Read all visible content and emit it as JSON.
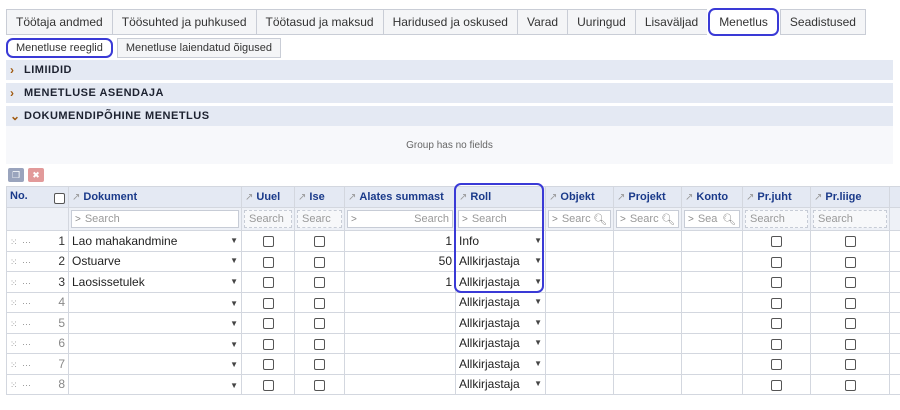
{
  "top_tabs": [
    "Töötaja andmed",
    "Töösuhted ja puhkused",
    "Töötasud ja maksud",
    "Haridused ja oskused",
    "Varad",
    "Uuringud",
    "Lisaväljad",
    "Menetlus",
    "Seadistused"
  ],
  "active_top_tab": "Menetlus",
  "sub_tabs": [
    "Menetluse reeglid",
    "Menetluse laiendatud õigused"
  ],
  "groups": {
    "limiidid": "LIMIIDID",
    "asendaja": "MENETLUSE ASENDAJA",
    "dokument": "DOKUMENDIPÕHINE MENETLUS",
    "empty_note": "Group has no fields"
  },
  "columns": {
    "no": "No.",
    "dokument": "Dokument",
    "uuel": "Uuel",
    "ise": "Ise",
    "alates": "Alates summast",
    "roll": "Roll",
    "objekt": "Objekt",
    "projekt": "Projekt",
    "konto": "Konto",
    "prjuht": "Pr.juht",
    "prliige": "Pr.liige"
  },
  "filters": {
    "dokument": "Search",
    "uuel": "Search",
    "ise": "Searc",
    "alates": "Search",
    "roll": "Search",
    "objekt": "Searc",
    "projekt": "Searc",
    "konto": "Sea",
    "prjuht": "Search",
    "prliige": "Search"
  },
  "rows": [
    {
      "no": "1",
      "dokument": "Lao mahakandmine",
      "alates": "1",
      "roll": "Info"
    },
    {
      "no": "2",
      "dokument": "Ostuarve",
      "alates": "50",
      "roll": "Allkirjastaja"
    },
    {
      "no": "3",
      "dokument": "Laosissetulek",
      "alates": "1",
      "roll": "Allkirjastaja"
    },
    {
      "no": "4",
      "dokument": "",
      "alates": "",
      "roll": "Allkirjastaja"
    },
    {
      "no": "5",
      "dokument": "",
      "alates": "",
      "roll": "Allkirjastaja"
    },
    {
      "no": "6",
      "dokument": "",
      "alates": "",
      "roll": "Allkirjastaja"
    },
    {
      "no": "7",
      "dokument": "",
      "alates": "",
      "roll": "Allkirjastaja"
    },
    {
      "no": "8",
      "dokument": "",
      "alates": "",
      "roll": "Allkirjastaja"
    }
  ],
  "colors": {
    "accent": "#3a3ad6",
    "header_bg": "#e4e9f3",
    "header_text": "#1a3a8a"
  }
}
